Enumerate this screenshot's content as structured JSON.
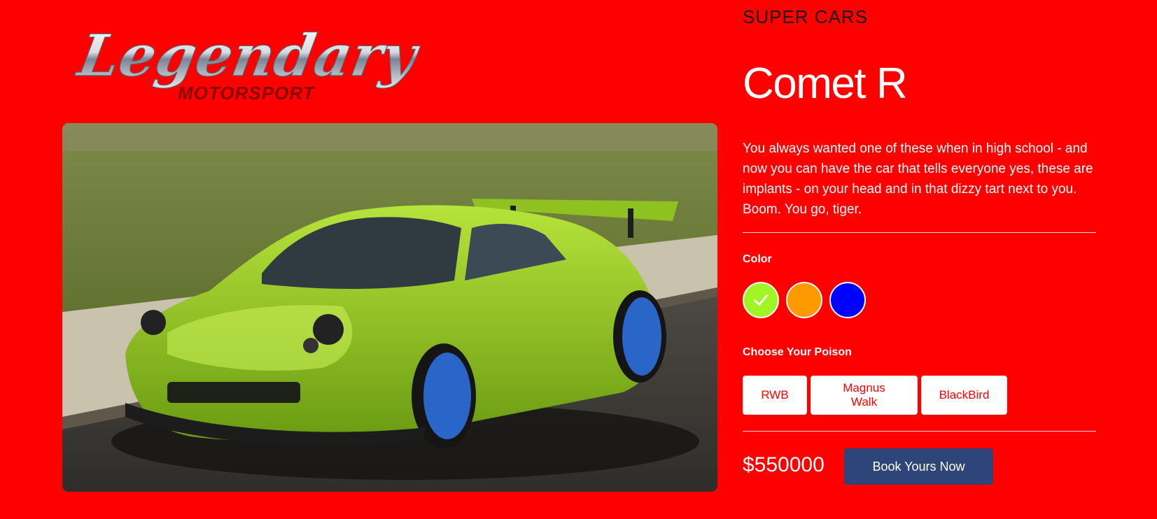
{
  "logo": {
    "line1": "Legendary",
    "line2": "MOTORSPORT"
  },
  "product": {
    "category": "SUPER CARS",
    "title": "Comet R",
    "description": "You always wanted one of these when in high school - and now you can have the car that tells everyone yes, these are implants - on your head and in that dizzy tart next to you. Boom. You go, tiger.",
    "color_label": "Color",
    "colors": [
      {
        "name": "lime",
        "hex": "#a2f525",
        "selected": true,
        "icon": "check-icon"
      },
      {
        "name": "orange",
        "hex": "#ff9900",
        "selected": false
      },
      {
        "name": "blue",
        "hex": "#0000ff",
        "selected": false
      }
    ],
    "variant_label": "Choose Your Poison",
    "variants": [
      "RWB",
      "Magnus Walk",
      "BlackBird"
    ],
    "price": "$550000",
    "cta_label": "Book Yours Now"
  },
  "theme": {
    "background": "#ff0000",
    "button": "#2d4578"
  }
}
